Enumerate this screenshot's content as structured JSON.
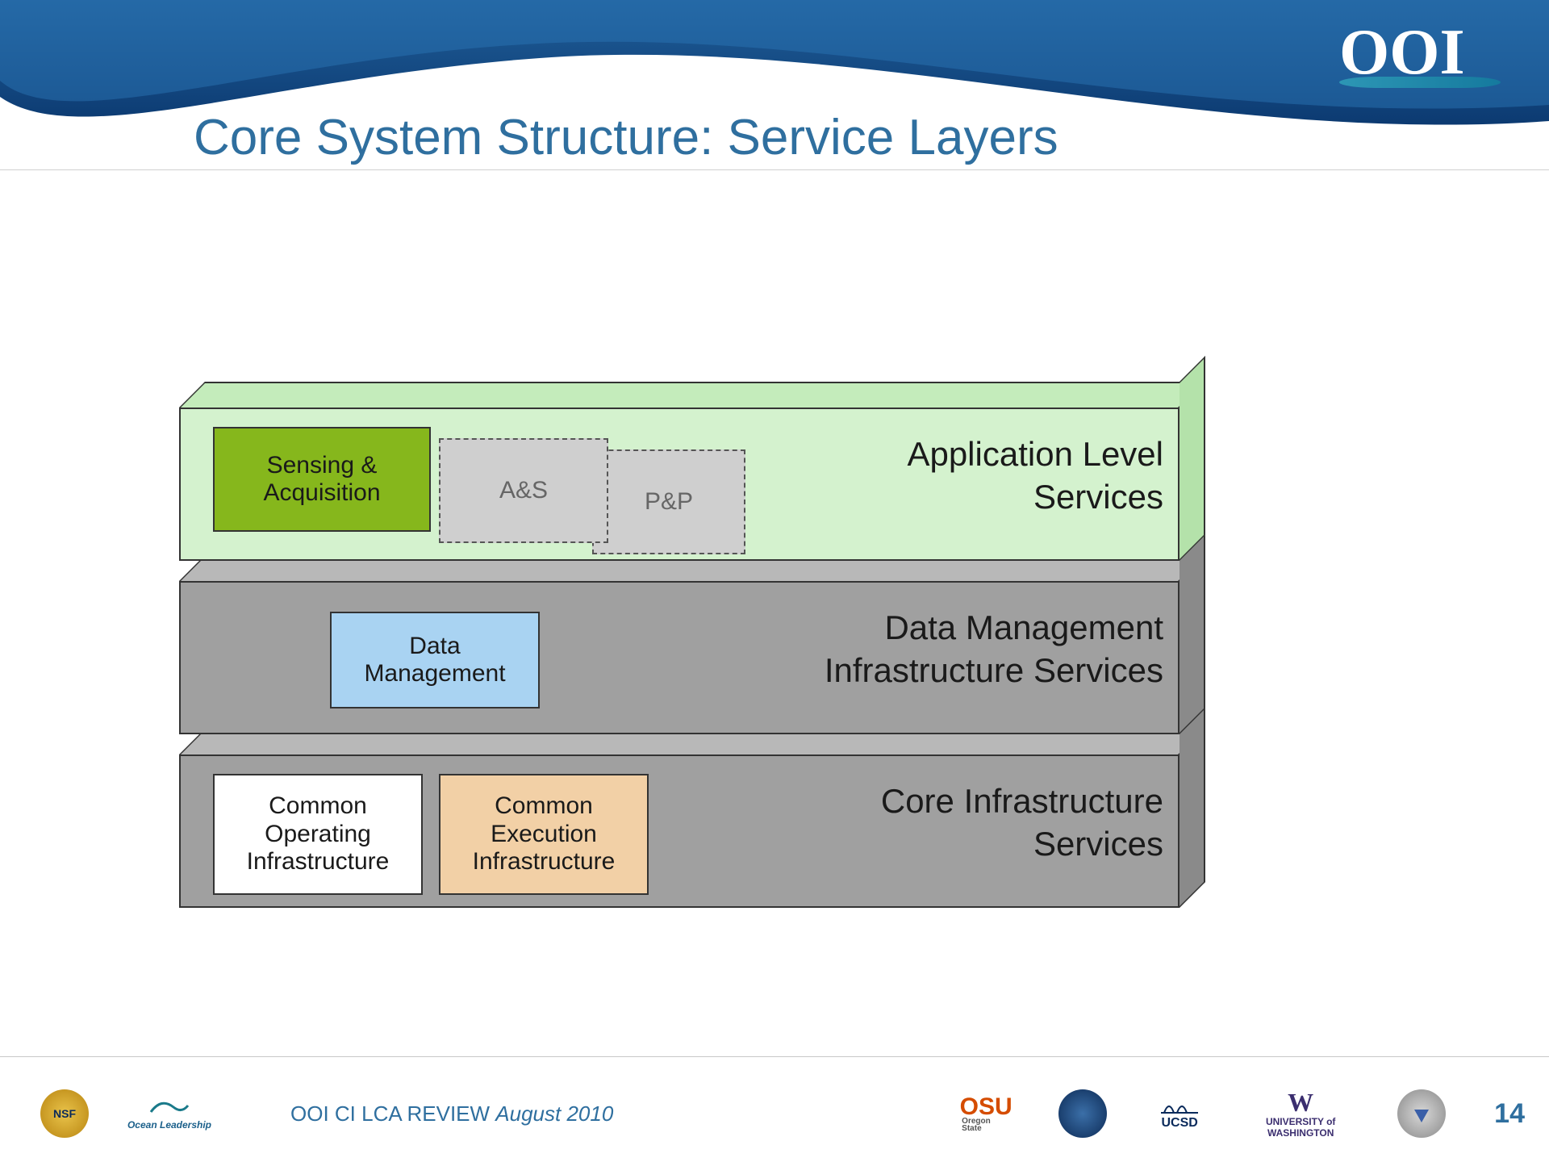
{
  "header": {
    "logo_text": "OOI",
    "title": "Core System Structure: Service Layers"
  },
  "layers": {
    "application": {
      "title_line1": "Application Level",
      "title_line2": "Services",
      "boxes": {
        "sensing": "Sensing &\nAcquisition",
        "as": "A&S",
        "pp": "P&P"
      }
    },
    "data_management": {
      "title_line1": "Data Management",
      "title_line2": "Infrastructure Services",
      "boxes": {
        "dm": "Data\nManagement"
      }
    },
    "core": {
      "title_line1": "Core Infrastructure",
      "title_line2": "Services",
      "boxes": {
        "coi": "Common\nOperating\nInfrastructure",
        "cei": "Common\nExecution\nInfrastructure"
      }
    }
  },
  "footer": {
    "review_text_main": "OOI CI LCA REVIEW ",
    "review_text_ital": "August 2010",
    "page_number": "14",
    "logos": {
      "nsf": "NSF",
      "ocean_leadership": "Ocean Leadership",
      "osu": "OSU",
      "osu_sub": "Oregon State",
      "round": "",
      "ucsd": "UCSD",
      "uw_w": "W",
      "uw_line1": "UNIVERSITY of",
      "uw_line2": "WASHINGTON",
      "round2": ""
    }
  }
}
